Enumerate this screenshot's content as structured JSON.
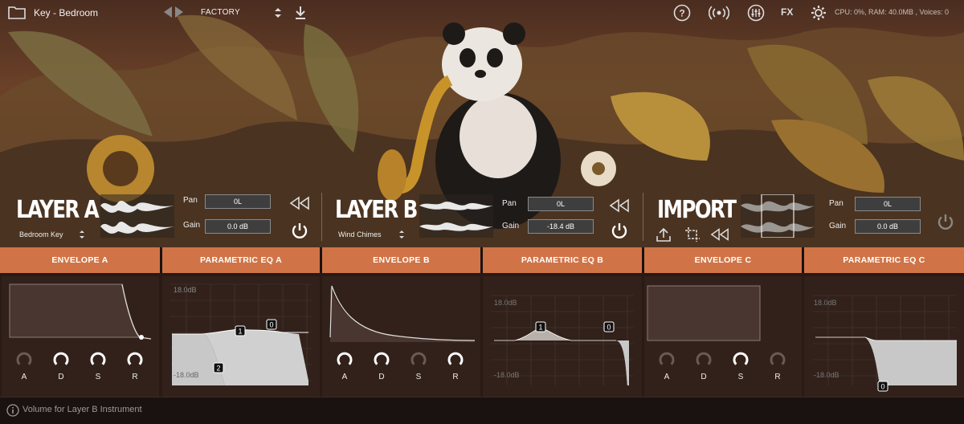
{
  "topbar": {
    "preset_name": "Key - Bedroom",
    "bank": "FACTORY",
    "cpu_status": "CPU: 0%, RAM: 40.0MB , Voices: 0",
    "fx_label": "FX",
    "icons": [
      "folder-icon",
      "prev-arrow-icon",
      "next-arrow-icon",
      "select-arrows-icon",
      "download-icon",
      "help-icon",
      "broadcast-icon",
      "mixer-icon",
      "gear-icon"
    ]
  },
  "layers": [
    {
      "title": "LAYER A",
      "instrument": "Bedroom Key",
      "pan_label": "Pan",
      "pan_value": "0L",
      "gain_label": "Gain",
      "gain_value": "0.0 dB"
    },
    {
      "title": "LAYER B",
      "instrument": "Wind Chimes",
      "pan_label": "Pan",
      "pan_value": "0L",
      "gain_label": "Gain",
      "gain_value": "-18.4 dB"
    },
    {
      "title": "IMPORT",
      "instrument": "",
      "pan_label": "Pan",
      "pan_value": "0L",
      "gain_label": "Gain",
      "gain_value": "0.0 dB"
    }
  ],
  "sections": {
    "env_a": "ENVELOPE A",
    "eq_a": "PARAMETRIC EQ A",
    "env_b": "ENVELOPE B",
    "eq_b": "PARAMETRIC EQ B",
    "env_c": "ENVELOPE C",
    "eq_c": "PARAMETRIC EQ C"
  },
  "envelope_knobs": {
    "labels": [
      "A",
      "D",
      "S",
      "R"
    ],
    "env_a_active": [
      false,
      true,
      true,
      true
    ],
    "env_b_active": [
      true,
      true,
      false,
      true
    ],
    "env_c_active": [
      false,
      false,
      true,
      false
    ]
  },
  "eq": {
    "eq_a_top": "18.0dB",
    "eq_a_bottom": "-18.0dB",
    "eq_a_nodes": [
      "1",
      "0",
      "2"
    ],
    "eq_b_top": "18.0dB",
    "eq_b_bottom": "-18.0dB",
    "eq_b_nodes": [
      "1",
      "0"
    ],
    "eq_c_top": "18.0dB",
    "eq_c_bottom": "-18.0dB",
    "eq_c_nodes": [
      "0"
    ]
  },
  "status": {
    "text": "Volume for Layer B Instrument"
  },
  "colors": {
    "accent": "#d07447",
    "panel_bg": "#32211a",
    "box_bg": "#3e3e3e"
  }
}
